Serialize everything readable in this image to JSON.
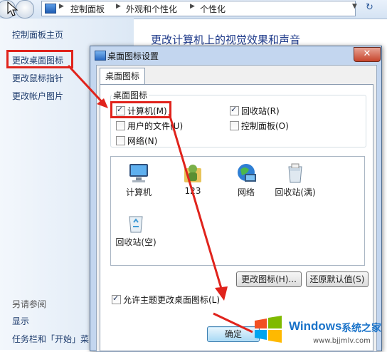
{
  "breadcrumb": {
    "items": [
      "控制面板",
      "外观和个性化",
      "个性化"
    ]
  },
  "left_pane": {
    "links": [
      "控制面板主页",
      "更改桌面图标",
      "更改鼠标指针",
      "更改帐户图片"
    ],
    "see_also_title": "另请参阅",
    "see_also_links": [
      "显示",
      "任务栏和「开始」菜"
    ]
  },
  "right_title": "更改计算机上的视觉效果和声音",
  "dialog": {
    "title": "桌面图标设置",
    "close_label": "✕",
    "tab_label": "桌面图标",
    "group_label": "桌面图标",
    "checkboxes": [
      {
        "label": "计算机(M)",
        "checked": true
      },
      {
        "label": "回收站(R)",
        "checked": true
      },
      {
        "label": "用户的文件(U)",
        "checked": false
      },
      {
        "label": "控制面板(O)",
        "checked": false
      },
      {
        "label": "网络(N)",
        "checked": false
      }
    ],
    "icons": [
      "计算机",
      "123",
      "网络",
      "回收站(满)",
      "回收站(空)"
    ],
    "change_icon_button": "更改图标(H)...",
    "restore_default_button": "还原默认值(S)",
    "allow_themes_label": "允许主题更改桌面图标(L)",
    "allow_themes_checked": true,
    "ok_button": "确定"
  },
  "watermark": {
    "brand": "Windows",
    "site_name": "系统之家",
    "url": "www.bjjmlv.com"
  },
  "colors": {
    "annotation_red": "#e0231c",
    "link_blue": "#1d3b6c",
    "title_blue": "#1e3a8a"
  }
}
